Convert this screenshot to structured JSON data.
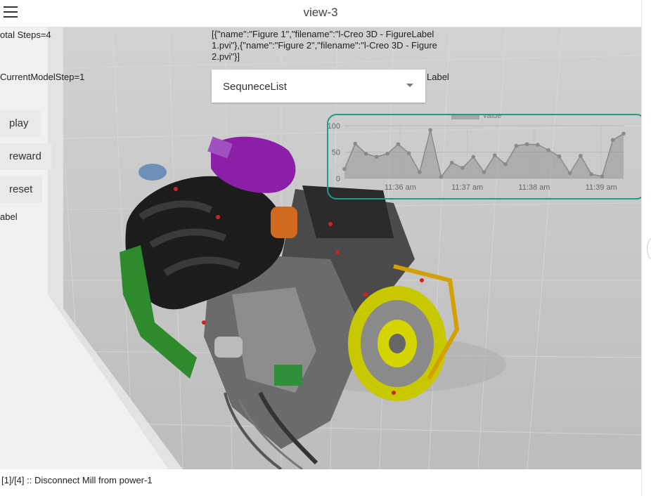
{
  "app": {
    "title": "view-3"
  },
  "menu": {
    "icon": "hamburger-menu-icon"
  },
  "overlay": {
    "total_steps": "otal Steps=4",
    "current_step": "CurrentModelStep=1",
    "figures_json": "[{\"name\":\"Figure 1\",\"filename\":\"l-Creo 3D - FigureLabel 1.pvi\"},{\"name\":\"Figure 2\",\"filename\":\"l-Creo 3D - Figure 2.pvi\"}]",
    "label_right": "Label",
    "label_left": "abel"
  },
  "sequence_select": {
    "selected": "SequneceList",
    "icon": "chevron-down-icon"
  },
  "buttons": {
    "play": "play",
    "reward": "reward",
    "reset": "reset"
  },
  "chart_data": {
    "type": "area",
    "title": "",
    "legend": [
      "value"
    ],
    "legend_placement": "top-center",
    "ylim": [
      0,
      100
    ],
    "yticks": [
      "0",
      "50",
      "100"
    ],
    "xticks": [
      "11:36 am",
      "11:37 am",
      "11:38 am",
      "11:39 am"
    ],
    "grid": true,
    "series": [
      {
        "name": "value",
        "values": [
          18,
          66,
          47,
          41,
          47,
          65,
          48,
          12,
          92,
          3,
          30,
          20,
          41,
          12,
          44,
          27,
          62,
          65,
          64,
          54,
          42,
          10,
          43,
          8,
          4,
          73,
          85
        ]
      }
    ]
  },
  "status": {
    "text": "[1]/[4] :: Disconnect Mill from power-1"
  },
  "colors": {
    "chart_border": "#1e9c86",
    "area_fill": "#8a8a8a"
  }
}
